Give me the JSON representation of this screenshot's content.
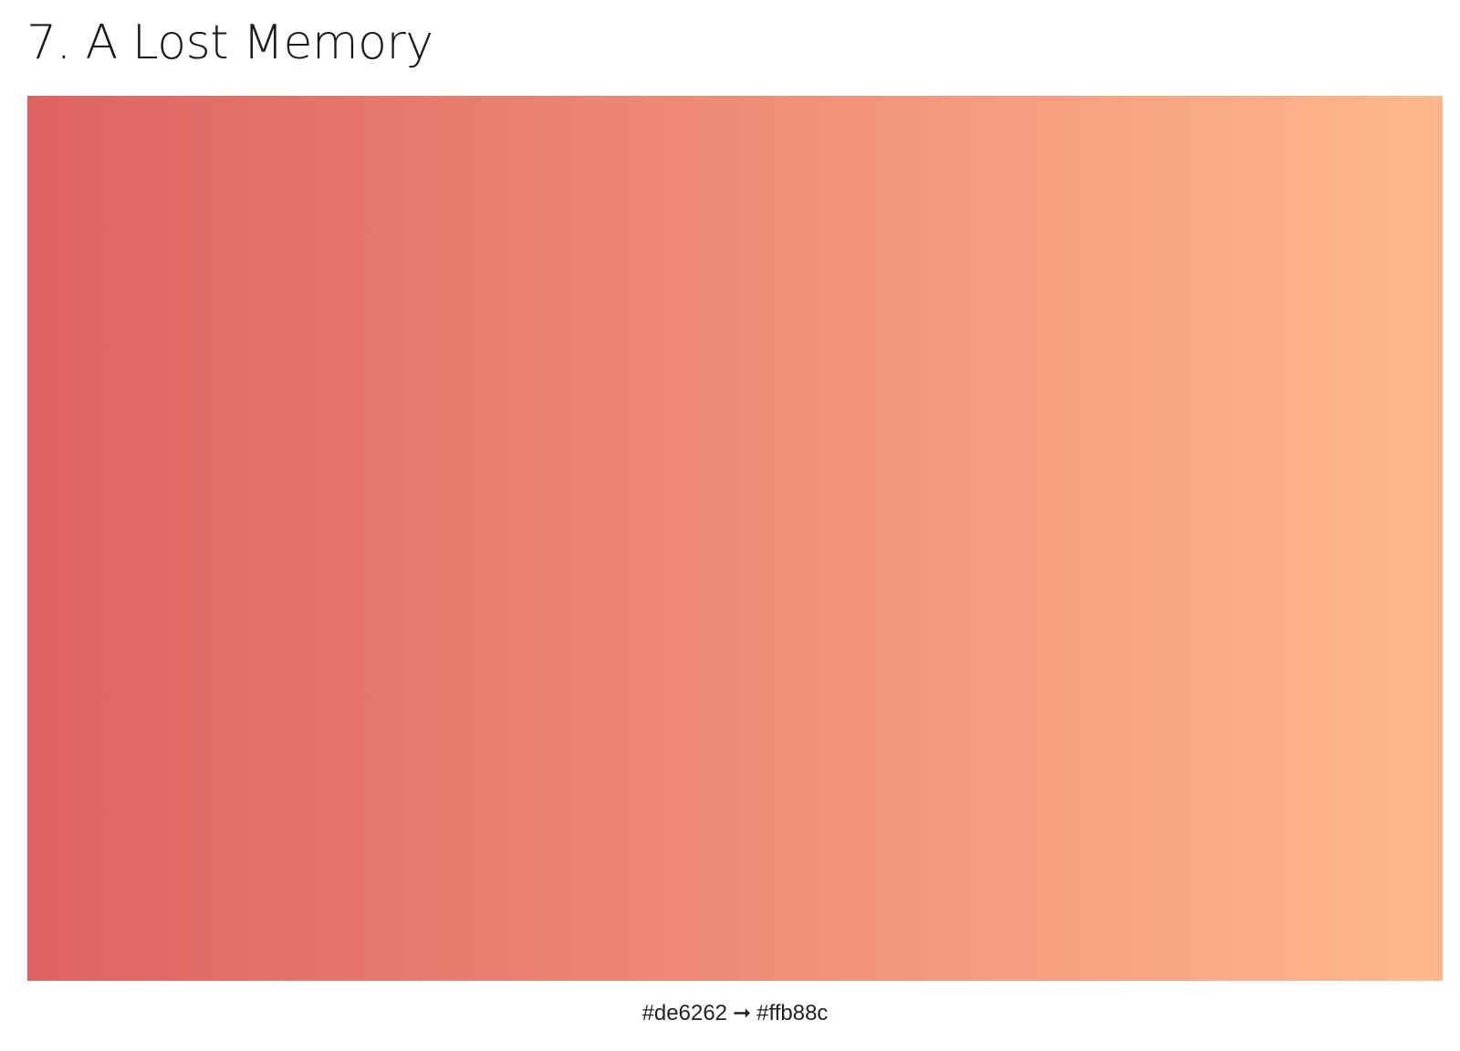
{
  "title": "7. A Lost Memory",
  "gradient": {
    "start_color": "#de6262",
    "end_color": "#ffb88c",
    "arrow": "➞"
  }
}
